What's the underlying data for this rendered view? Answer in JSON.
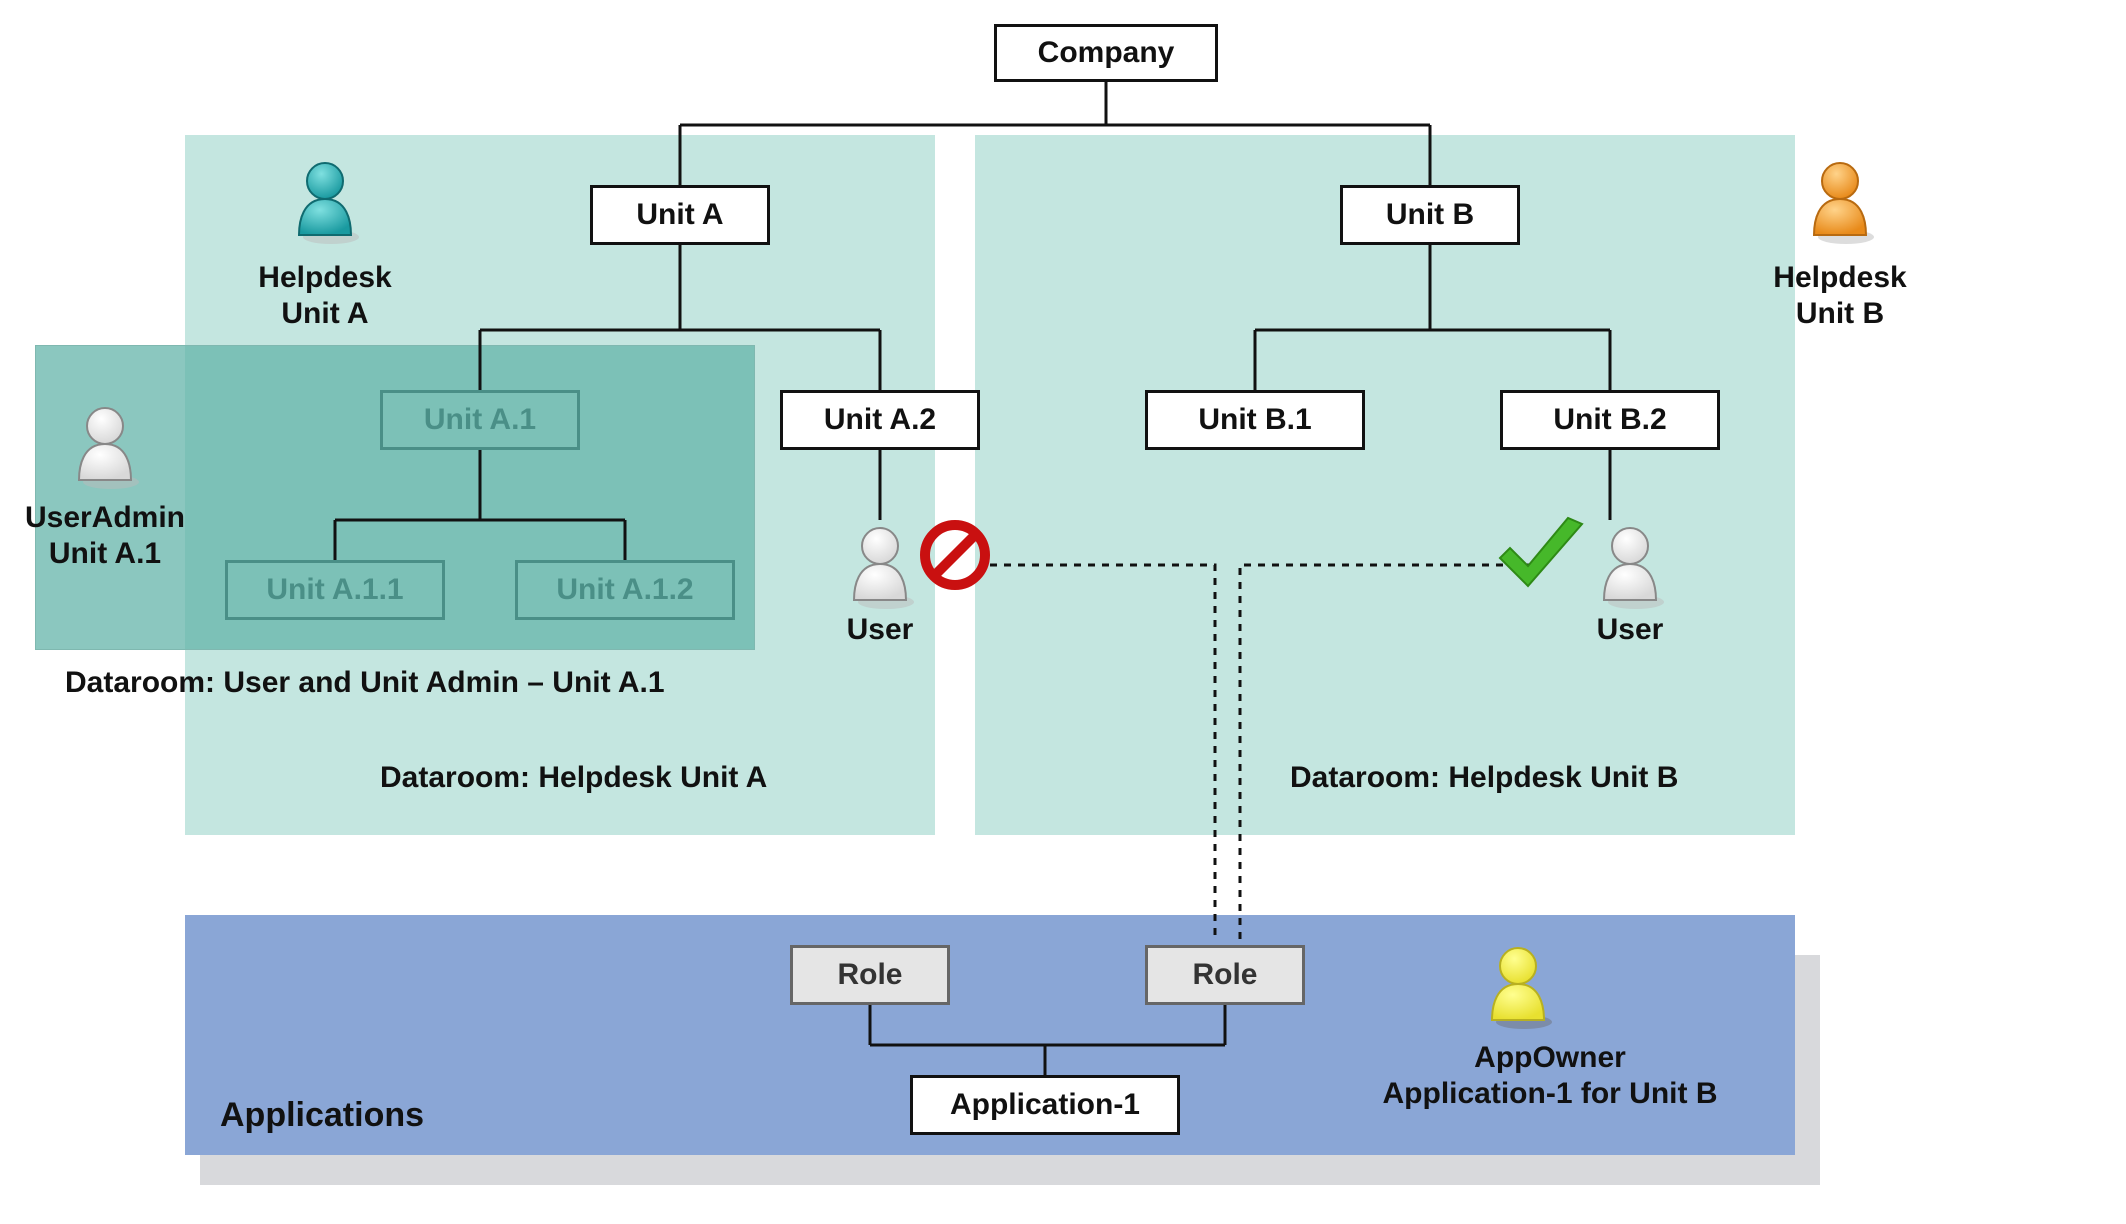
{
  "nodes": {
    "company": "Company",
    "unitA": "Unit A",
    "unitB": "Unit B",
    "unitA1": "Unit A.1",
    "unitA2": "Unit A.2",
    "unitA11": "Unit A.1.1",
    "unitA12": "Unit A.1.2",
    "unitB1": "Unit B.1",
    "unitB2": "Unit B.2",
    "role1": "Role",
    "role2": "Role",
    "app1": "Application-1"
  },
  "labels": {
    "helpdeskA": "Helpdesk\nUnit A",
    "helpdeskB": "Helpdesk\nUnit B",
    "userAdmin": "UserAdmin\nUnit A.1",
    "userA2": "User",
    "userB2": "User",
    "dataroomA1": "Dataroom: User and Unit Admin – Unit A.1",
    "dataroomHelpA": "Dataroom: Helpdesk Unit A",
    "dataroomHelpB": "Dataroom: Helpdesk Unit B",
    "applications": "Applications",
    "appOwner": "AppOwner\nApplication-1 for Unit B"
  },
  "icons": {
    "personTeal": "person-icon",
    "personWhite": "person-icon",
    "personOrange": "person-icon",
    "personYellow": "person-icon",
    "no": "no-entry-icon",
    "check": "checkmark-icon"
  },
  "colors": {
    "regionLight": "#c4e6e0",
    "regionMid": "#7cc0b7",
    "regionBlue": "#8aa6d6",
    "boxBorder": "#111111",
    "mutedBorder": "#4a8f87",
    "greyFill": "#e5e5e5"
  }
}
